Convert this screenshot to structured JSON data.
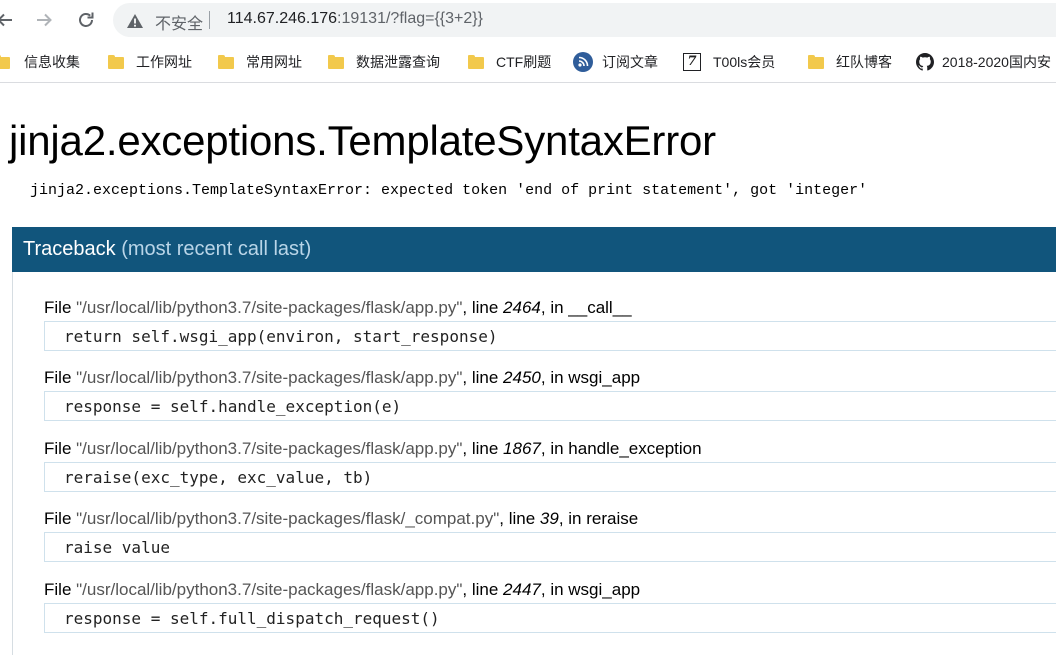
{
  "browser": {
    "security_label": "不安全",
    "url_host": "114.67.246.176",
    "url_rest": ":19131/?flag={{3+2}}",
    "bookmarks": [
      {
        "label": "信息收集",
        "icon": "folder-icon"
      },
      {
        "label": "工作网址",
        "icon": "folder-icon"
      },
      {
        "label": "常用网址",
        "icon": "folder-icon"
      },
      {
        "label": "数据泄露查询",
        "icon": "folder-icon"
      },
      {
        "label": "CTF刷题",
        "icon": "folder-icon"
      },
      {
        "label": "订阅文章",
        "icon": "rss-icon"
      },
      {
        "label": "T00ls会员",
        "icon": "seven-icon"
      },
      {
        "label": "红队博客",
        "icon": "folder-icon"
      },
      {
        "label": "2018-2020国内安",
        "icon": "github-icon"
      }
    ]
  },
  "error": {
    "title": "jinja2.exceptions.TemplateSyntaxError",
    "message": "jinja2.exceptions.TemplateSyntaxError: expected token 'end of print statement', got 'integer'"
  },
  "traceback": {
    "heading": "Traceback",
    "heading_sub": "(most recent call last)",
    "frames": [
      {
        "file": "\"/usr/local/lib/python3.7/site-packages/flask/app.py\"",
        "line": "2464",
        "func": "__call__",
        "code": "return self.wsgi_app(environ, start_response)"
      },
      {
        "file": "\"/usr/local/lib/python3.7/site-packages/flask/app.py\"",
        "line": "2450",
        "func": "wsgi_app",
        "code": "response = self.handle_exception(e)"
      },
      {
        "file": "\"/usr/local/lib/python3.7/site-packages/flask/app.py\"",
        "line": "1867",
        "func": "handle_exception",
        "code": "reraise(exc_type, exc_value, tb)"
      },
      {
        "file": "\"/usr/local/lib/python3.7/site-packages/flask/_compat.py\"",
        "line": "39",
        "func": "reraise",
        "code": "raise value"
      },
      {
        "file": "\"/usr/local/lib/python3.7/site-packages/flask/app.py\"",
        "line": "2447",
        "func": "wsgi_app",
        "code": "response = self.full_dispatch_request()"
      }
    ],
    "file_word": "File ",
    "line_word": ", line ",
    "in_word": ", in "
  }
}
